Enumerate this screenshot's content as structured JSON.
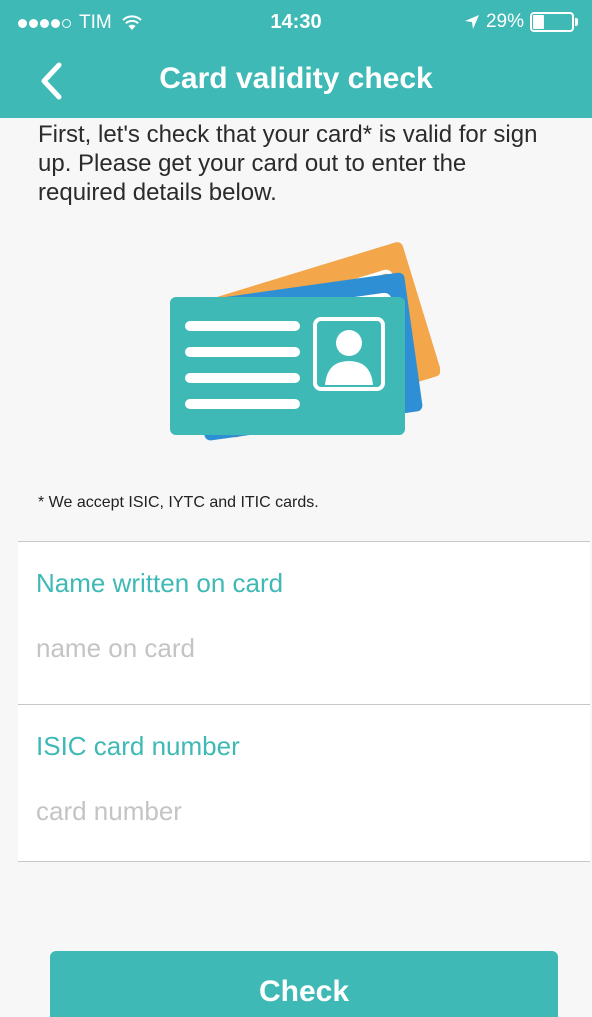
{
  "status_bar": {
    "carrier": "TIM",
    "time": "14:30",
    "battery_percent": "29%",
    "battery_level": 0.29
  },
  "nav": {
    "title": "Card validity check",
    "back_icon": "chevron-left-icon"
  },
  "intro": {
    "text": "First, let's check that your card* is valid for sign up. Please get your card out to enter the required details below."
  },
  "illustration": {
    "icon": "id-cards-icon",
    "colors": {
      "back_card": "#f3a64a",
      "middle_card": "#2e8fd4",
      "front_card": "#3fb9b5"
    }
  },
  "note": {
    "text": "* We accept ISIC, IYTC and ITIC cards."
  },
  "form": {
    "name_label": "Name written on card",
    "name_placeholder": "name on card",
    "name_value": "",
    "number_label": "ISIC card number",
    "number_placeholder": "card number",
    "number_value": ""
  },
  "actions": {
    "check_label": "Check"
  },
  "colors": {
    "accent": "#3fb9b5",
    "background": "#f7f7f7"
  }
}
